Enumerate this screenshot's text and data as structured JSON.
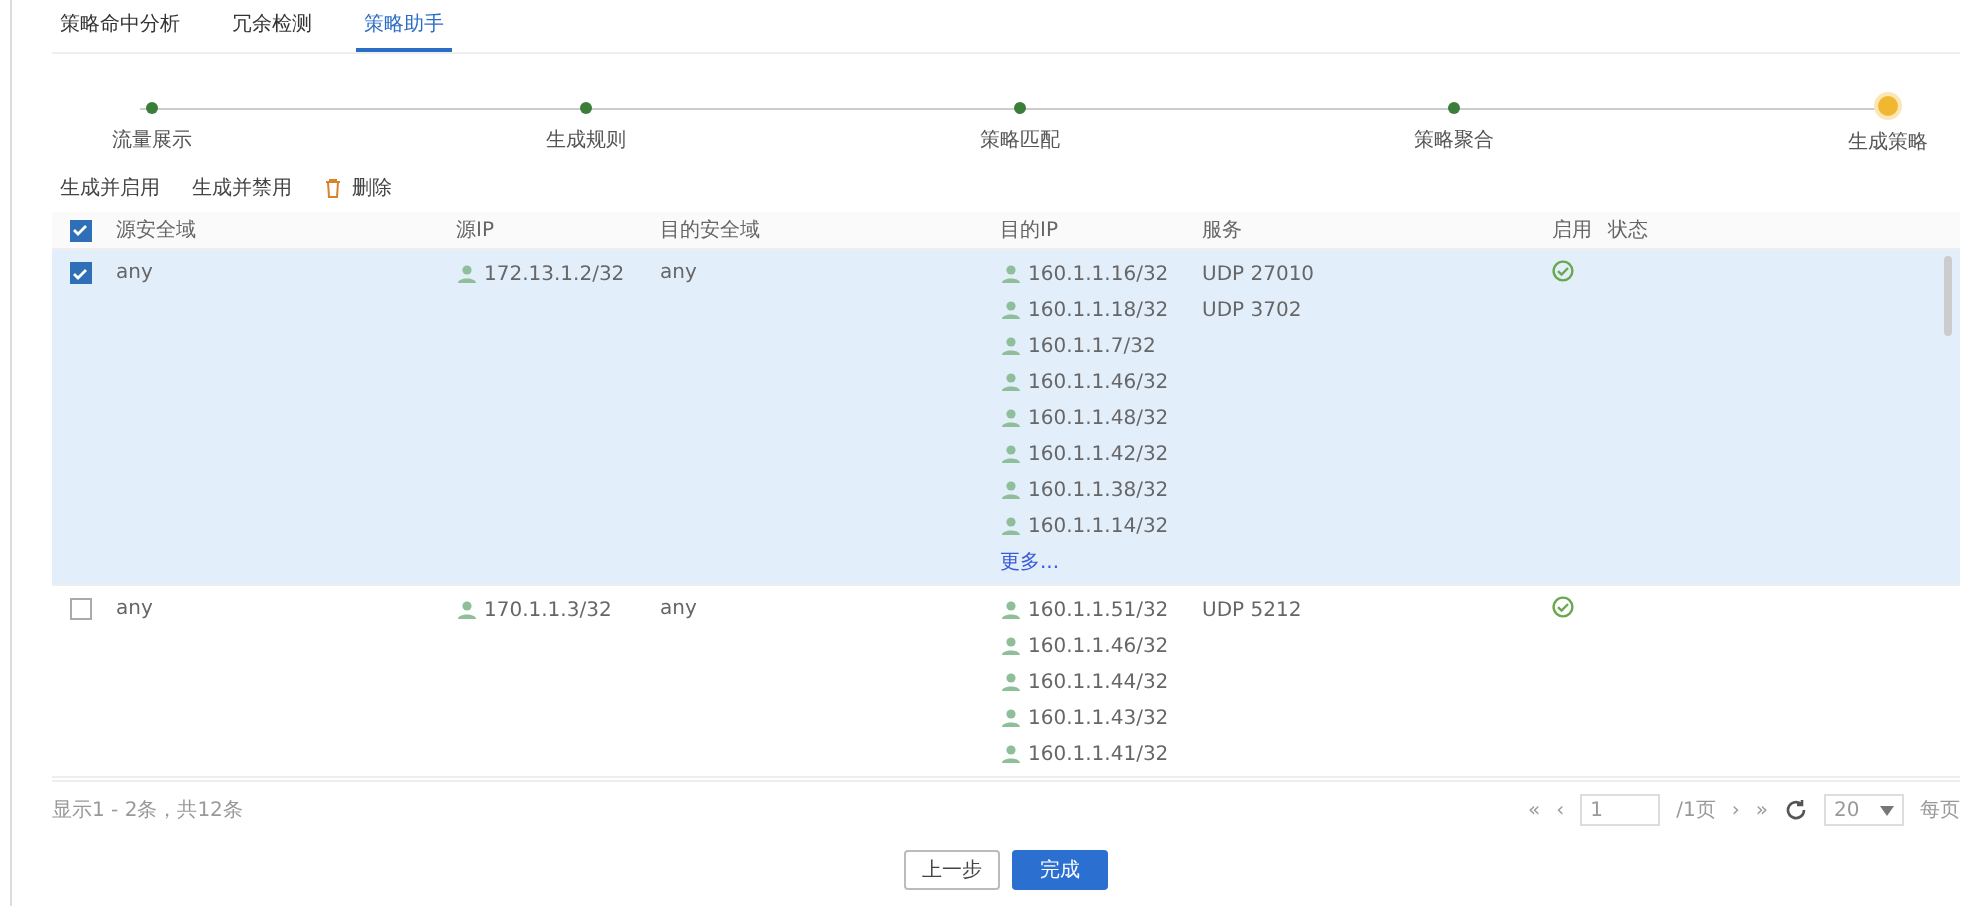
{
  "tabs": [
    {
      "label": "策略命中分析",
      "selected": false
    },
    {
      "label": "冗余检测",
      "selected": false
    },
    {
      "label": "策略助手",
      "selected": true
    }
  ],
  "steps": [
    {
      "label": "流量展示",
      "current": false
    },
    {
      "label": "生成规则",
      "current": false
    },
    {
      "label": "策略匹配",
      "current": false
    },
    {
      "label": "策略聚合",
      "current": false
    },
    {
      "label": "生成策略",
      "current": true
    }
  ],
  "toolbar": {
    "enable_button": "生成并启用",
    "disable_button": "生成并禁用",
    "delete_button": "删除"
  },
  "table": {
    "all_checked": true,
    "columns": [
      "源安全域",
      "源IP",
      "目的安全域",
      "目的IP",
      "服务",
      "启用",
      "状态"
    ],
    "rows": [
      {
        "checked": true,
        "selected": true,
        "src_zone": "any",
        "src_ip": [
          "172.13.1.2/32"
        ],
        "dst_zone": "any",
        "dst_ip": [
          "160.1.1.16/32",
          "160.1.1.18/32",
          "160.1.1.7/32",
          "160.1.1.46/32",
          "160.1.1.48/32",
          "160.1.1.42/32",
          "160.1.1.38/32",
          "160.1.1.14/32"
        ],
        "more_link": "更多...",
        "services": [
          "UDP 27010",
          "UDP 3702"
        ],
        "enabled": true
      },
      {
        "checked": false,
        "selected": false,
        "src_zone": "any",
        "src_ip": [
          "170.1.1.3/32"
        ],
        "dst_zone": "any",
        "dst_ip": [
          "160.1.1.51/32",
          "160.1.1.46/32",
          "160.1.1.44/32",
          "160.1.1.43/32",
          "160.1.1.41/32"
        ],
        "services": [
          "UDP 5212"
        ],
        "enabled": true
      }
    ]
  },
  "footer": {
    "summary": "显示1 - 2条，共12条",
    "first": "«",
    "prev": "‹",
    "page": "1",
    "pages": "/1页",
    "next": "›",
    "last": "»",
    "page_size": "20",
    "per_page": "每页"
  },
  "buttons": {
    "back": "上一步",
    "finish": "完成"
  }
}
